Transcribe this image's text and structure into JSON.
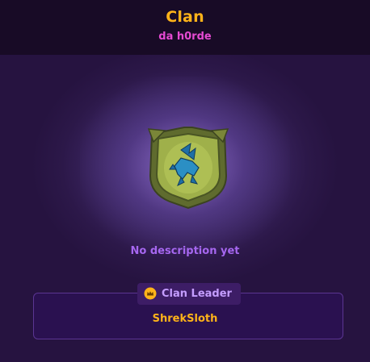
{
  "header": {
    "title": "Clan",
    "clan_name": "da h0rde"
  },
  "emblem": {
    "icon": "pegasus-emblem-icon",
    "shield_color": "#7c8e3a",
    "symbol_color": "#2b8fc4"
  },
  "description": "No description yet",
  "leader": {
    "label": "Clan Leader",
    "icon": "crown-icon",
    "name": "ShrekSloth"
  },
  "colors": {
    "accent_gold": "#ffb319",
    "accent_pink": "#e54ad2",
    "accent_purple": "#a667f0",
    "background": "#2c1849"
  }
}
